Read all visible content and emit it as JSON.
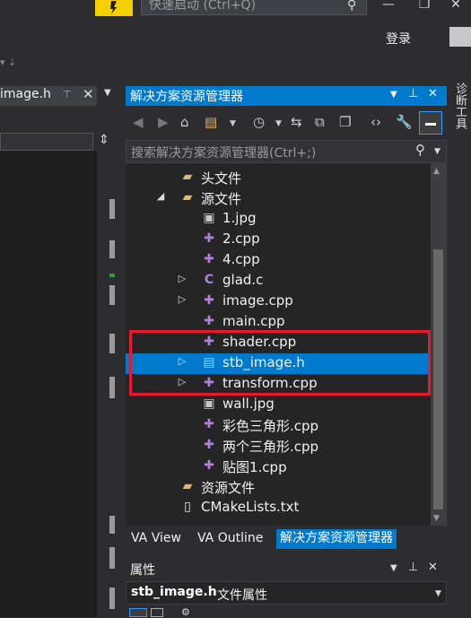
{
  "window": {
    "quick_launch_placeholder": "快速启动 (Ctrl+Q)",
    "sign_in": "登录",
    "minimize": "—",
    "maximize": "❐",
    "close": "✕"
  },
  "editor": {
    "tab_label": "image.h",
    "tab_close": "✕",
    "tab_pin": "⊤"
  },
  "solution_explorer": {
    "title": "解决方案资源管理器",
    "search_placeholder": "搜索解决方案资源管理器(Ctrl+;)",
    "tree": [
      {
        "label": "头文件",
        "icon": "folder-icon",
        "expander": ""
      },
      {
        "label": "源文件",
        "icon": "folder-open-icon",
        "expander": "◢"
      },
      {
        "label": "1.jpg",
        "icon": "image-file-icon",
        "expander": ""
      },
      {
        "label": "2.cpp",
        "icon": "cpp-file-icon",
        "expander": ""
      },
      {
        "label": "4.cpp",
        "icon": "cpp-file-icon",
        "expander": ""
      },
      {
        "label": "glad.c",
        "icon": "c-file-icon",
        "expander": "▷"
      },
      {
        "label": "image.cpp",
        "icon": "cpp-file-icon",
        "expander": "▷"
      },
      {
        "label": "main.cpp",
        "icon": "cpp-file-icon",
        "expander": ""
      },
      {
        "label": "shader.cpp",
        "icon": "cpp-file-icon",
        "expander": ""
      },
      {
        "label": "stb_image.h",
        "icon": "header-file-icon",
        "expander": "▷",
        "selected": true
      },
      {
        "label": "transform.cpp",
        "icon": "cpp-file-icon",
        "expander": "▷"
      },
      {
        "label": "wall.jpg",
        "icon": "image-file-icon",
        "expander": ""
      },
      {
        "label": "彩色三角形.cpp",
        "icon": "cpp-file-icon",
        "expander": ""
      },
      {
        "label": "两个三角形.cpp",
        "icon": "cpp-file-icon",
        "expander": ""
      },
      {
        "label": "贴图1.cpp",
        "icon": "cpp-file-icon",
        "expander": ""
      },
      {
        "label": "资源文件",
        "icon": "folder-icon",
        "expander": ""
      },
      {
        "label": "CMakeLists.txt",
        "icon": "text-file-icon",
        "expander": ""
      }
    ],
    "bottom_tabs": [
      "VA View",
      "VA Outline",
      "解决方案资源管理器"
    ]
  },
  "properties": {
    "title": "属性",
    "selected_name": "stb_image.h",
    "selected_type": "文件属性"
  },
  "side_tab": "诊断工具",
  "colors": {
    "accent": "#007acc",
    "highlight_box": "#e8192c",
    "background": "#2d2d30"
  }
}
